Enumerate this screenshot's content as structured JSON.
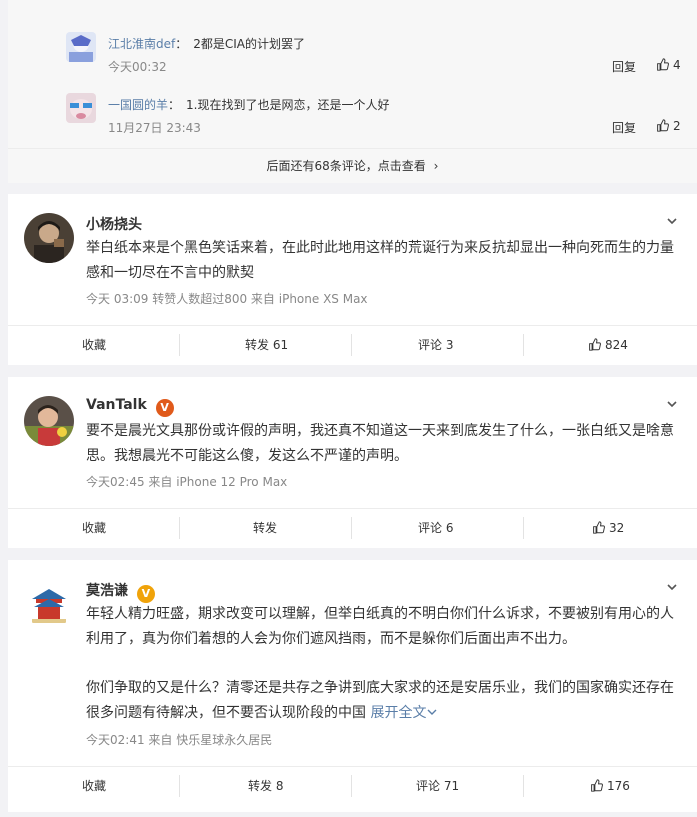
{
  "replies_box": {
    "replies": [
      {
        "username": "江北淮南def",
        "text": "2都是CIA的计划罢了",
        "time": "今天00:32",
        "reply_label": "回复",
        "likes": "4"
      },
      {
        "username": "一国圆的羊",
        "text": "1.现在找到了也是网恋，还是一个人好",
        "time": "11月27日 23:43",
        "reply_label": "回复",
        "likes": "2"
      }
    ],
    "more_link": "后面还有68条评论，点击查看",
    "more_chevron": "›"
  },
  "posts": [
    {
      "username": "小杨挠头",
      "verified": false,
      "text": "举白纸本来是个黑色笑话来着，在此时此地用这样的荒诞行为来反抗却显出一种向死而生的力量感和一切尽在不言中的默契",
      "meta": "今天 03:09 转赞人数超过800  来自 iPhone XS Max",
      "actions": {
        "favorite": "收藏",
        "repost": "转发 61",
        "comment": "评论 3",
        "likes": "824"
      }
    },
    {
      "username": "VanTalk",
      "verified": true,
      "badge_color": "#e05a1b",
      "text": "要不是晨光文具那份或许假的声明，我还真不知道这一天来到底发生了什么，一张白纸又是啥意思。我想晨光不可能这么傻，发这么不严谨的声明。",
      "meta": "今天02:45  来自 iPhone 12 Pro Max",
      "actions": {
        "favorite": "收藏",
        "repost": "转发",
        "comment": "评论 6",
        "likes": "32"
      }
    },
    {
      "username": "莫浩谦",
      "verified": true,
      "badge_color": "#f0a30a",
      "text_p1": "年轻人精力旺盛，期求改变可以理解，但举白纸真的不明白你们什么诉求，不要被别有用心的人利用了，真为你们着想的人会为你们遮风挡雨，而不是躲你们后面出声不出力。",
      "text_p2": "你们争取的又是什么？清零还是共存之争讲到底大家求的还是安居乐业，我们的国家确实还存在很多问题有待解决，但不要否认现阶段的中国",
      "expand_label": "展开全文",
      "meta": "今天02:41  来自 快乐星球永久居民",
      "actions": {
        "favorite": "收藏",
        "repost": "转发 8",
        "comment": "评论 71",
        "likes": "176"
      }
    }
  ],
  "colors": {
    "link": "#5a7ea8",
    "meta": "#888888",
    "background": "#f2f2f5"
  },
  "icons": {
    "like": "thumb-up-icon",
    "more": "chevron-down-icon",
    "verified": "verified-badge-icon"
  }
}
